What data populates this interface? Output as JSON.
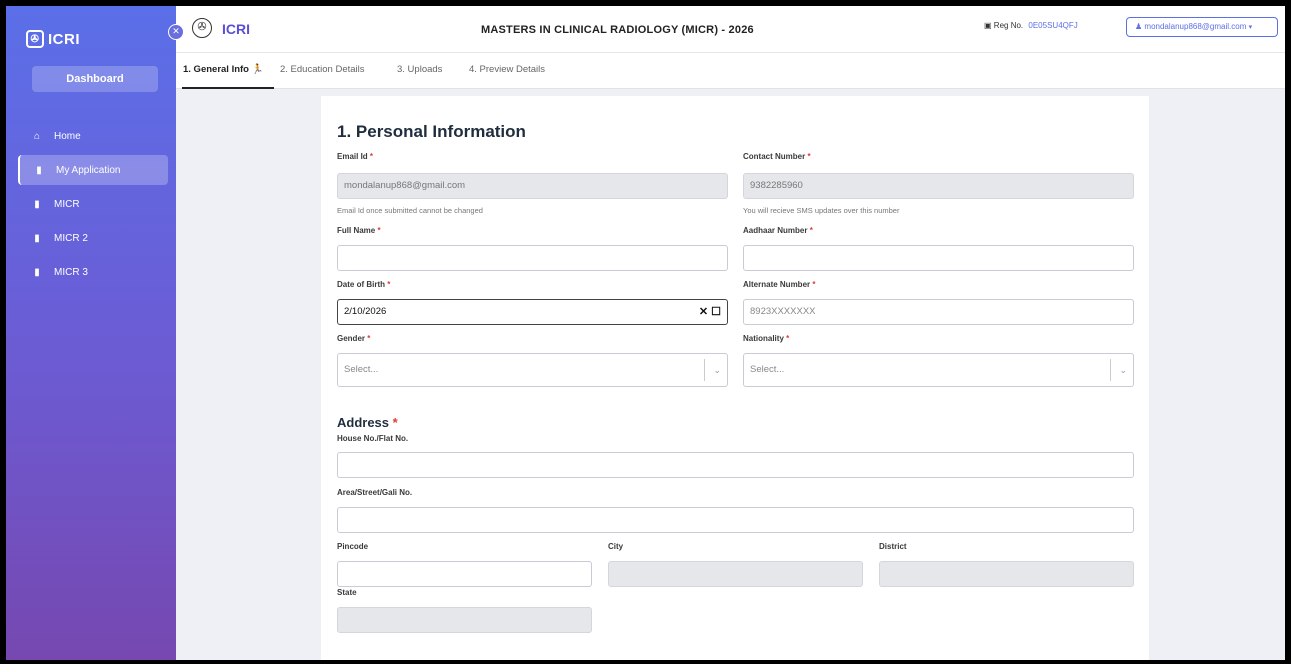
{
  "sidebar": {
    "brand": "ICRI",
    "logo_icon": "icri-emblem-icon",
    "dashboard_label": "Dashboard",
    "items": [
      {
        "label": "Home",
        "icon": "home-icon"
      },
      {
        "label": "My Application",
        "icon": "document-icon",
        "active": true
      },
      {
        "label": "MICR",
        "icon": "document-icon"
      },
      {
        "label": "MICR 2",
        "icon": "document-icon"
      },
      {
        "label": "MICR 3",
        "icon": "document-icon"
      }
    ]
  },
  "header": {
    "brand": "ICRI",
    "title": "MASTERS IN CLINICAL RADIOLOGY (MICR) - 2026",
    "reg_label": "Reg No.",
    "reg_value": "0E05SU4QFJ",
    "user_email": "mondalanup868@gmail.com"
  },
  "tabs": [
    {
      "label": "1. General Info",
      "active": true
    },
    {
      "label": "2. Education Details"
    },
    {
      "label": "3. Uploads"
    },
    {
      "label": "4. Preview Details"
    }
  ],
  "form": {
    "section_title": "1. Personal Information",
    "email": {
      "label": "Email Id",
      "value": "mondalanup868@gmail.com",
      "hint": "Email Id once submitted cannot be changed"
    },
    "contact": {
      "label": "Contact Number",
      "value": "9382285960",
      "hint": "You will recieve SMS updates over this number"
    },
    "full_name": {
      "label": "Full Name",
      "value": ""
    },
    "aadhaar": {
      "label": "Aadhaar Number",
      "value": ""
    },
    "dob": {
      "label": "Date of Birth",
      "value": "2/10/2026"
    },
    "alternate": {
      "label": "Alternate Number",
      "placeholder": "8923XXXXXXX"
    },
    "gender": {
      "label": "Gender",
      "placeholder": "Select..."
    },
    "nationality": {
      "label": "Nationality",
      "placeholder": "Select..."
    },
    "address_title": "Address",
    "house": {
      "label": "House No./Flat No."
    },
    "area": {
      "label": "Area/Street/Gali No."
    },
    "pincode": {
      "label": "Pincode"
    },
    "city": {
      "label": "City"
    },
    "district": {
      "label": "District"
    },
    "state": {
      "label": "State"
    },
    "required_mark": "*"
  },
  "colors": {
    "accent": "#5b6fe8",
    "required": "#e03a3a"
  }
}
